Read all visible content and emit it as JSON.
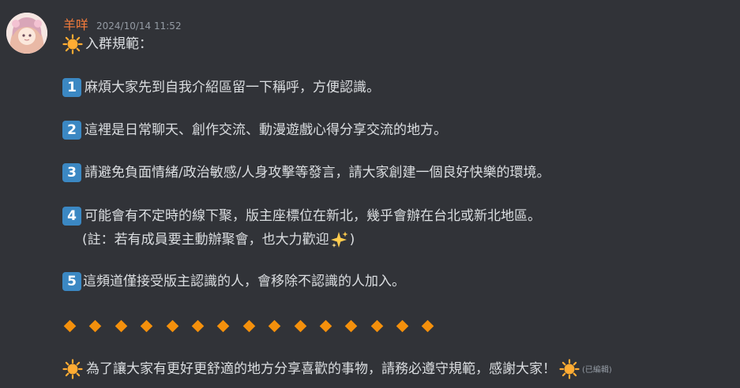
{
  "message": {
    "username": "羊咩",
    "timestamp": "2024/10/14 11:52",
    "title": "入群規範：",
    "rules": [
      {
        "num": "1",
        "text": "麻煩大家先到自我介紹區留一下稱呼，方便認識。"
      },
      {
        "num": "2",
        "text": "這裡是日常聊天、創作交流、動漫遊戲心得分享交流的地方。"
      },
      {
        "num": "3",
        "text": "請避免負面情緒/政治敏感/人身攻擊等發言，請大家創建一個良好快樂的環境。"
      },
      {
        "num": "4",
        "text": "可能會有不定時的線下聚，版主座標位在新北，幾乎會辦在台北或新北地區。"
      },
      {
        "num": "5",
        "text": "這頻道僅接受版主認識的人，會移除不認識的人加入。"
      }
    ],
    "note_prefix": "(註：若有成員要主動辦聚會，也大力歡迎",
    "note_suffix": ")",
    "closing": "為了讓大家有更好更舒適的地方分享喜歡的事物，請務必遵守規範，感謝大家！",
    "edited_label": "(已編輯)",
    "emoji": {
      "sun": "sun-emoji",
      "keycap": "keycap-digit-emoji",
      "sparkles": "sparkles-emoji",
      "diamond": "large-orange-diamond-emoji"
    },
    "colors": {
      "background": "#313338",
      "username": "#f57c3b",
      "text": "#dbdee1",
      "muted": "#949ba4",
      "keycap": "#3b88c3",
      "diamond": "#f4900c",
      "sun": "#ffac33"
    }
  }
}
